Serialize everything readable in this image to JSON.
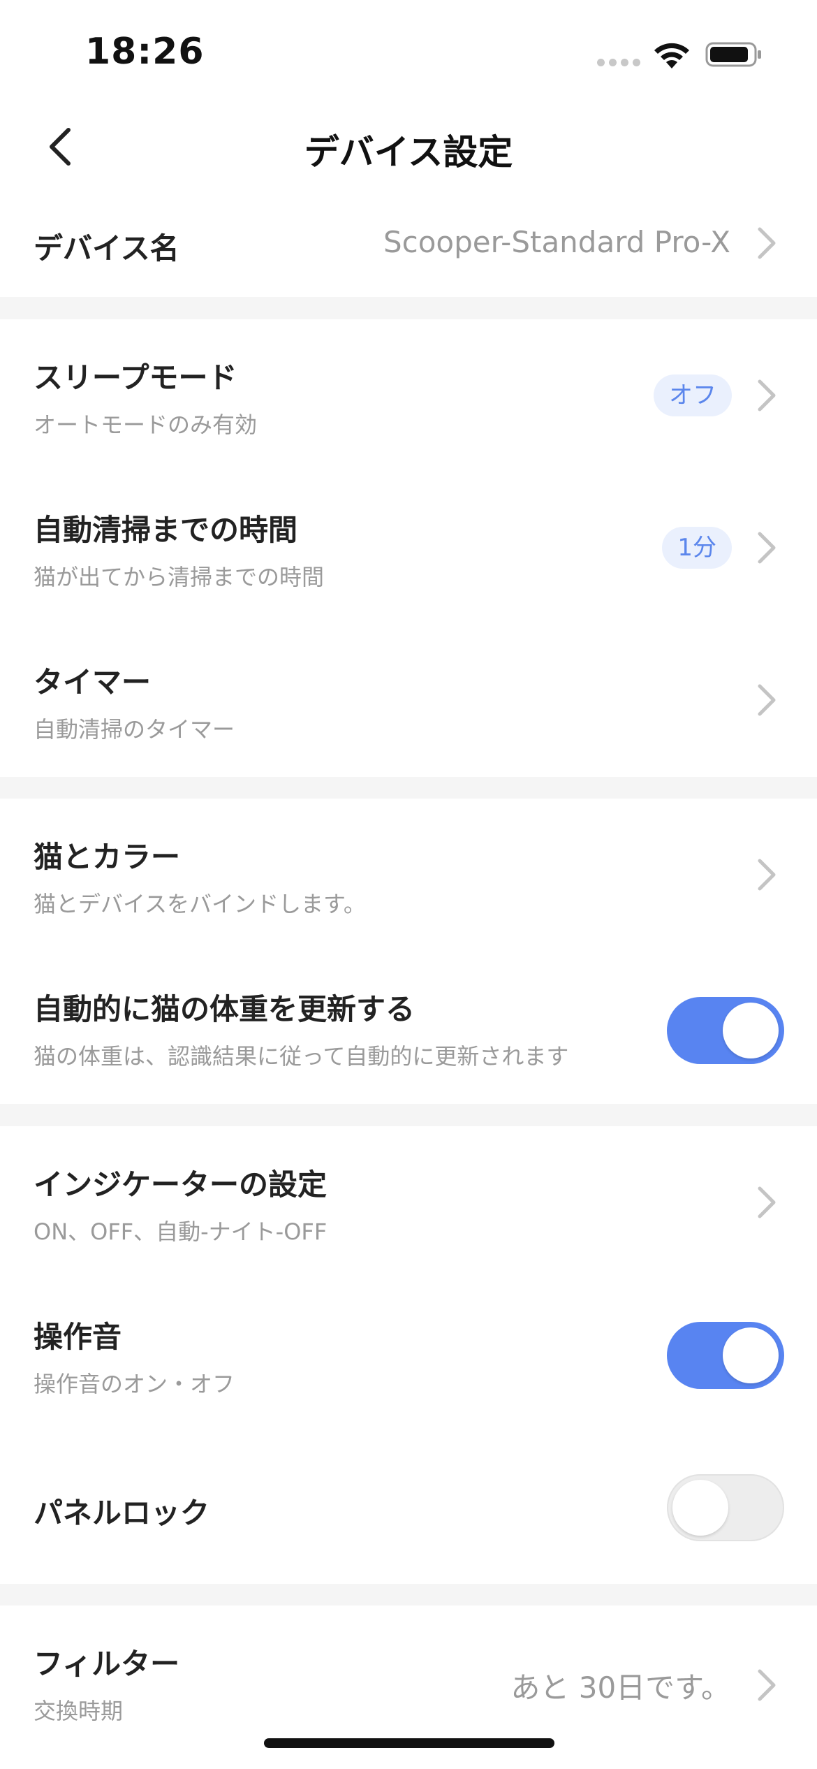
{
  "status_bar": {
    "time": "18:26"
  },
  "nav": {
    "title": "デバイス設定",
    "back_icon": "chevron-left-icon"
  },
  "device_name": {
    "title": "デバイス名",
    "value": "Scooper-Standard Pro-X"
  },
  "sleep_mode": {
    "title": "スリープモード",
    "subtitle": "オートモードのみ有効",
    "badge": "オフ"
  },
  "auto_clean": {
    "title": "自動清掃までの時間",
    "subtitle": "猫が出てから清掃までの時間",
    "badge": "1分"
  },
  "timer": {
    "title": "タイマー",
    "subtitle": "自動清掃のタイマー"
  },
  "cat_color": {
    "title": "猫とカラー",
    "subtitle": "猫とデバイスをバインドします。"
  },
  "auto_weight": {
    "title": "自動的に猫の体重を更新する",
    "subtitle": "猫の体重は、認識結果に従って自動的に更新されます",
    "enabled": true
  },
  "indicator": {
    "title": "インジケーターの設定",
    "subtitle": "ON、OFF、自動-ナイト-OFF"
  },
  "sound": {
    "title": "操作音",
    "subtitle": "操作音のオン・オフ",
    "enabled": true
  },
  "panel_lock": {
    "title": "パネルロック",
    "enabled": false
  },
  "filter": {
    "title": "フィルター",
    "subtitle": "交換時期",
    "value": "あと 30日です。"
  },
  "colors": {
    "accent": "#5884f1",
    "badge_bg": "#eaf0fd",
    "badge_text": "#5b86ec",
    "page_bg": "#f5f5f5"
  }
}
